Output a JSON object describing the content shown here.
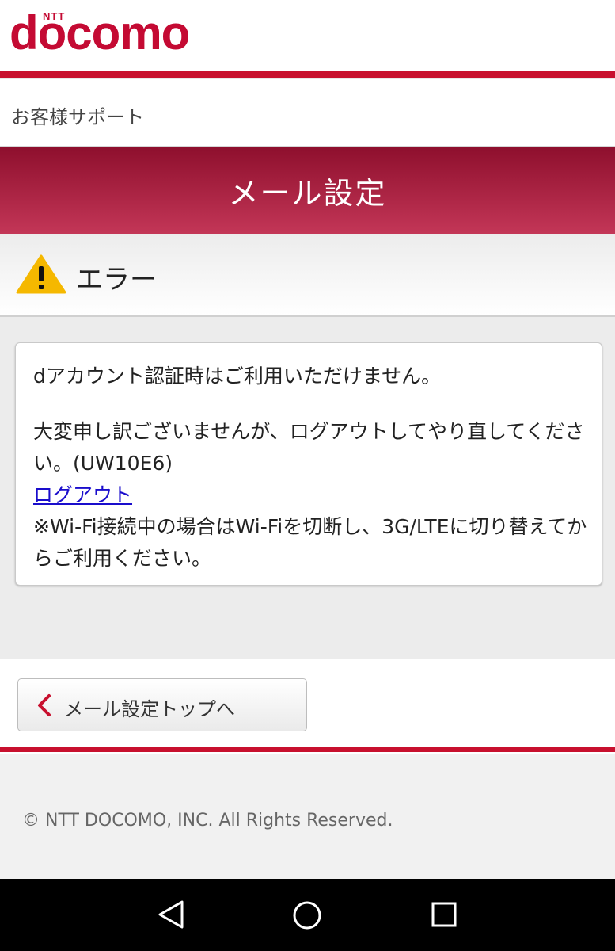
{
  "header": {
    "logo_ntt": "NTT",
    "logo_main": "docomo"
  },
  "support": {
    "label": "お客様サポート"
  },
  "banner": {
    "title": "メール設定"
  },
  "error": {
    "title": "エラー"
  },
  "message": {
    "line1": "dアカウント認証時はご利用いただけません。",
    "line2": "大変申し訳ございませんが、ログアウトしてやり直してください。(UW10E6)",
    "logout_link": "ログアウト",
    "line3": "※Wi-Fi接続中の場合はWi-Fiを切断し、3G/LTEに切り替えてからご利用ください。"
  },
  "back_button": {
    "label": "メール設定トップへ"
  },
  "footer": {
    "copyright": "© NTT DOCOMO, INC. All Rights Reserved."
  },
  "icons": {
    "warning": "warning-triangle-icon",
    "chevron": "chevron-left-icon",
    "nav": [
      "nav-back-icon",
      "nav-home-icon",
      "nav-recent-icon"
    ]
  },
  "colors": {
    "brand": "#c40a33",
    "banner_top": "#8e0f2d",
    "banner_bottom": "#c33657",
    "link": "#1a0dcc",
    "warning": "#f5b800"
  }
}
